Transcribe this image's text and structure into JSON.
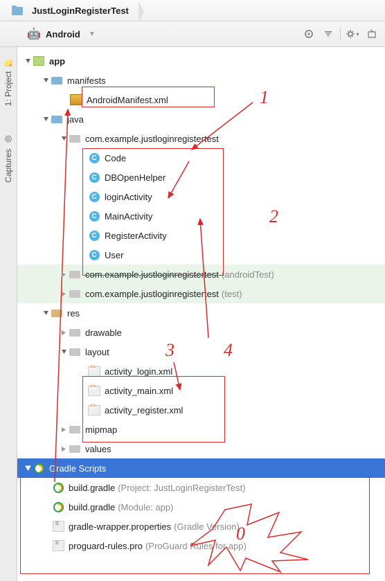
{
  "breadcrumb": {
    "root": "JustLoginRegisterTest"
  },
  "view": {
    "label": "Android"
  },
  "gutter": {
    "project": "1: Project",
    "captures": "Captures"
  },
  "tree": {
    "app": "app",
    "manifests": "manifests",
    "manifest_file": "AndroidManifest.xml",
    "java": "java",
    "pkg_main": "com.example.justloginregistertest",
    "classes": [
      "Code",
      "DBOpenHelper",
      "loginActivity",
      "MainActivity",
      "RegisterActivity",
      "User"
    ],
    "pkg_androidtest": "com.example.justloginregistertest",
    "pkg_androidtest_suffix": "(androidTest)",
    "pkg_test": "com.example.justloginregistertest",
    "pkg_test_suffix": "(test)",
    "res": "res",
    "drawable": "drawable",
    "layout": "layout",
    "layouts": [
      "activity_login.xml",
      "activity_main.xml",
      "activity_register.xml"
    ],
    "mipmap": "mipmap",
    "values": "values",
    "gradle_scripts": "Gradle Scripts",
    "gradle_items": [
      {
        "label": "build.gradle",
        "suffix": "(Project: JustLoginRegisterTest)"
      },
      {
        "label": "build.gradle",
        "suffix": "(Module: app)"
      },
      {
        "label": "gradle-wrapper.properties",
        "suffix": "(Gradle Version)"
      },
      {
        "label": "proguard-rules.pro",
        "suffix": "(ProGuard Rules for app)"
      }
    ]
  },
  "annotations": {
    "n0": "0",
    "n1": "1",
    "n2": "2",
    "n3": "3",
    "n4": "4"
  }
}
